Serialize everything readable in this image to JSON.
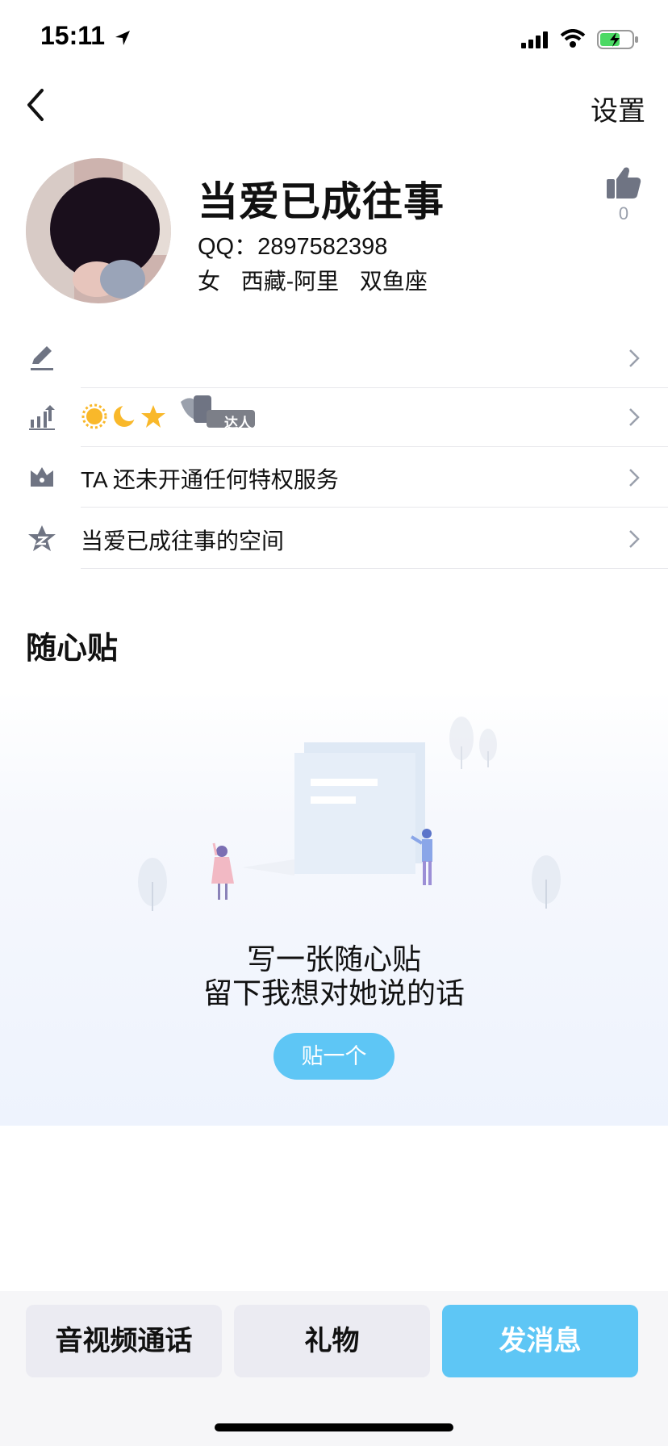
{
  "status_bar": {
    "time": "15:11"
  },
  "nav": {
    "settings_label": "设置"
  },
  "profile": {
    "nickname": "当爱已成往事",
    "qq": "QQ：2897582398",
    "gender": "女",
    "location": "西藏-阿里",
    "zodiac": "双鱼座",
    "like_count": "0"
  },
  "rows": [
    {
      "icon": "edit-icon",
      "label": ""
    },
    {
      "icon": "level-icon",
      "label": "",
      "badge": "达人"
    },
    {
      "icon": "privilege-icon",
      "label": "TA 还未开通任何特权服务"
    },
    {
      "icon": "qzone-icon",
      "label": "当爱已成往事的空间"
    }
  ],
  "section": {
    "title": "随心贴",
    "empty_line1": "写一张随心贴",
    "empty_line2": "留下我想对她说的话",
    "post_button": "贴一个"
  },
  "bottom_bar": {
    "call_label": "音视频通话",
    "gift_label": "礼物",
    "message_label": "发消息"
  },
  "colors": {
    "accent": "#5ec6f5",
    "icon_gray": "#6f7483",
    "button_gray": "#ebebf2"
  }
}
